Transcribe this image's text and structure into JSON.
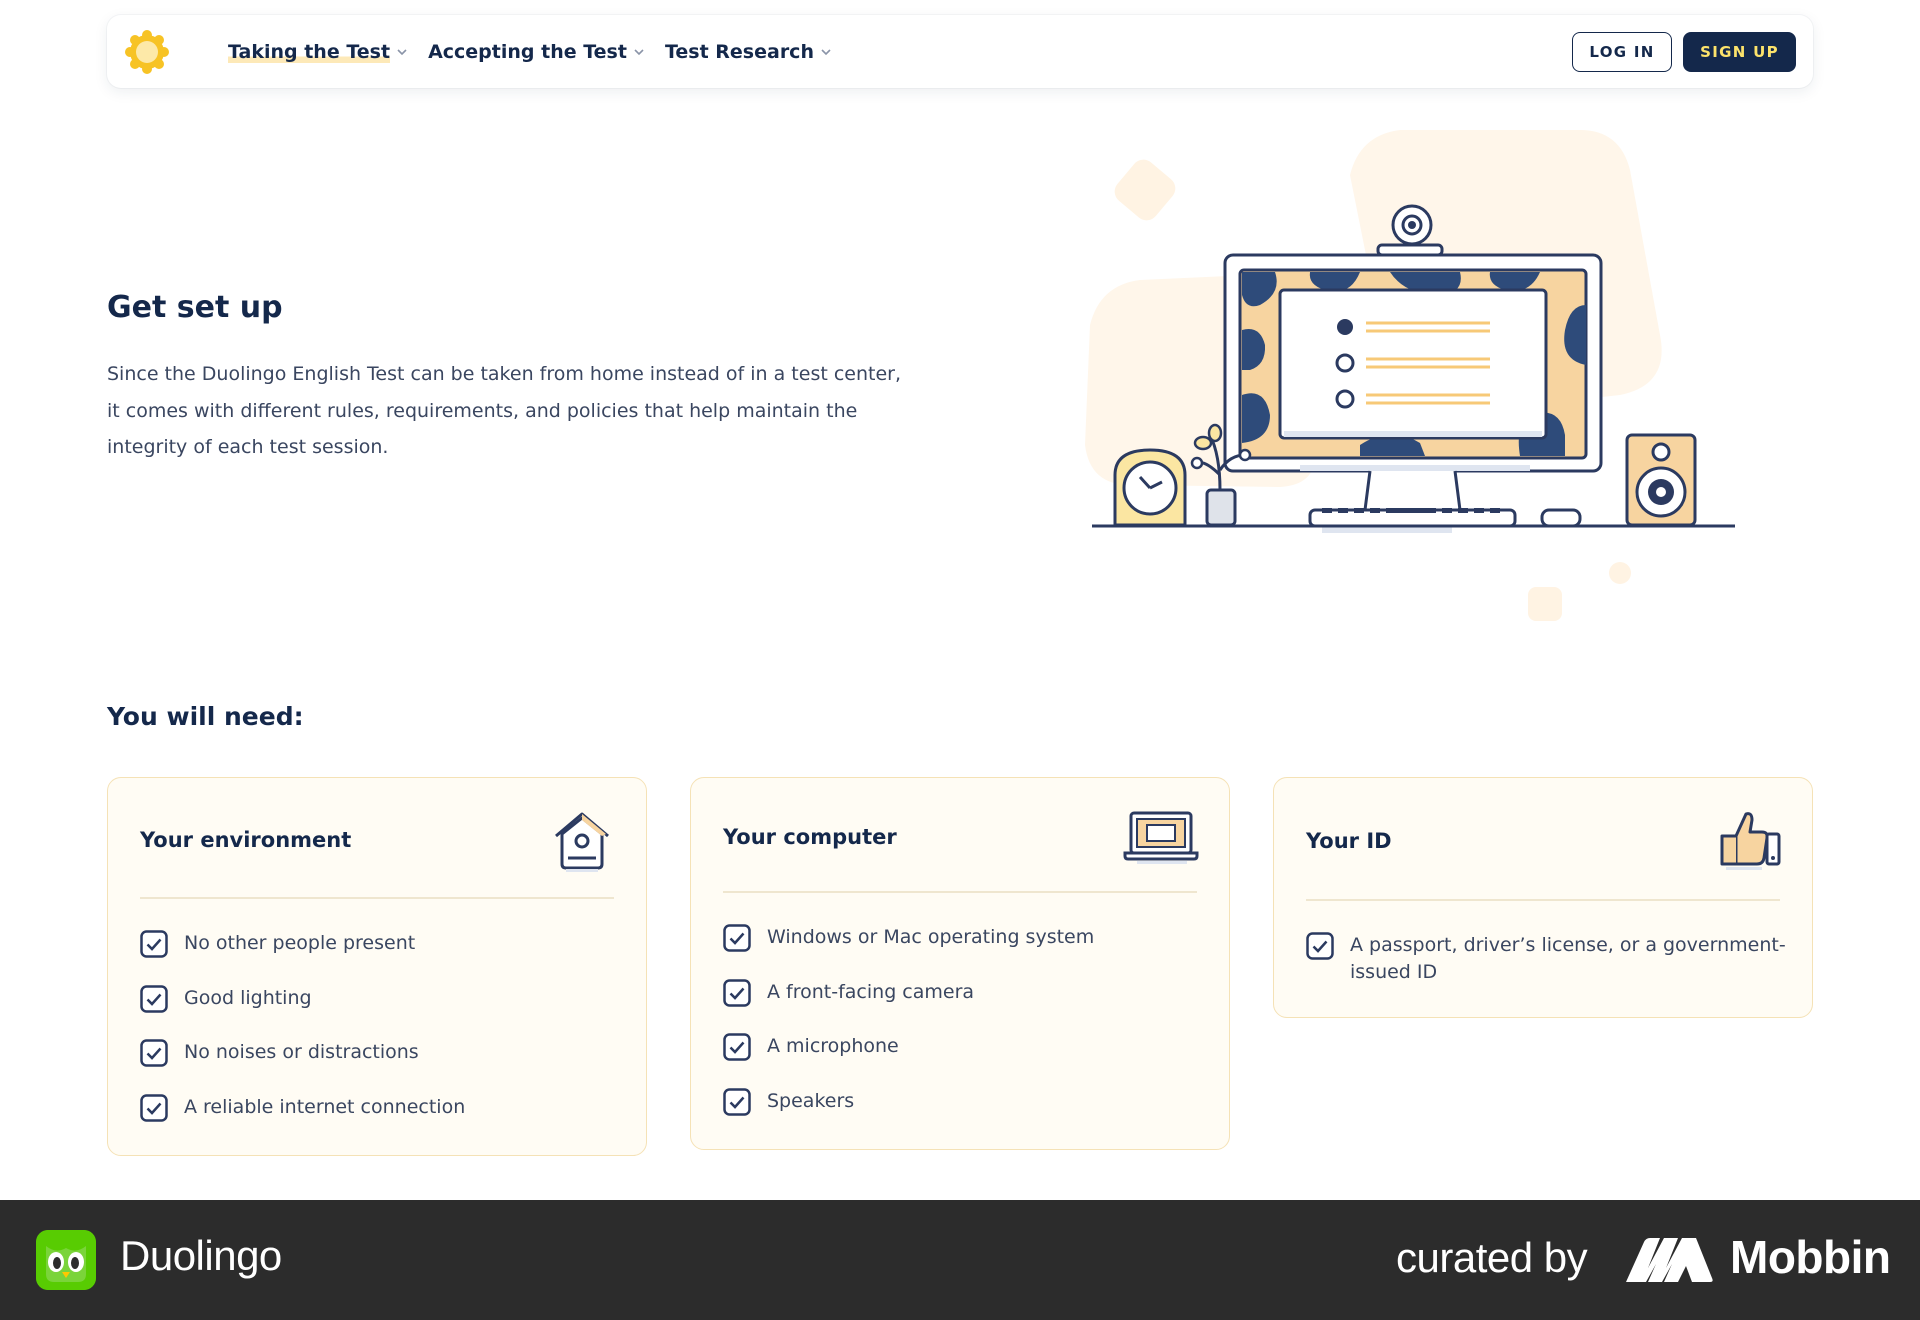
{
  "nav": {
    "links": [
      {
        "label": "Taking the Test",
        "active": true
      },
      {
        "label": "Accepting the Test",
        "active": false
      },
      {
        "label": "Test Research",
        "active": false
      }
    ],
    "login_label": "LOG IN",
    "signup_label": "SIGN UP"
  },
  "hero": {
    "title": "Get set up",
    "text": "Since the Duolingo English Test can be taken from home instead of in a test center, it comes with different rules, requirements, and policies that help maintain the integrity of each test session."
  },
  "need": {
    "title": "You will need:",
    "cards": [
      {
        "title": "Your environment",
        "icon": "birdhouse-icon",
        "items": [
          "No other people present",
          "Good lighting",
          "No noises or distractions",
          "A reliable internet connection"
        ]
      },
      {
        "title": "Your computer",
        "icon": "laptop-icon",
        "items": [
          "Windows or Mac operating system",
          "A front-facing camera",
          "A microphone",
          "Speakers"
        ]
      },
      {
        "title": "Your ID",
        "icon": "thumbs-up-icon",
        "items": [
          "A passport, driver’s license, or a government-issued ID"
        ]
      }
    ]
  },
  "footer": {
    "app_name": "Duolingo",
    "curated_by": "curated by",
    "brand": "Mobbin"
  },
  "colors": {
    "navy": "#14284b",
    "accent_yellow": "#fde36b",
    "card_bg": "#fffcf4",
    "card_border": "#f5e2b6",
    "footer_bg": "#2c2c2c"
  }
}
